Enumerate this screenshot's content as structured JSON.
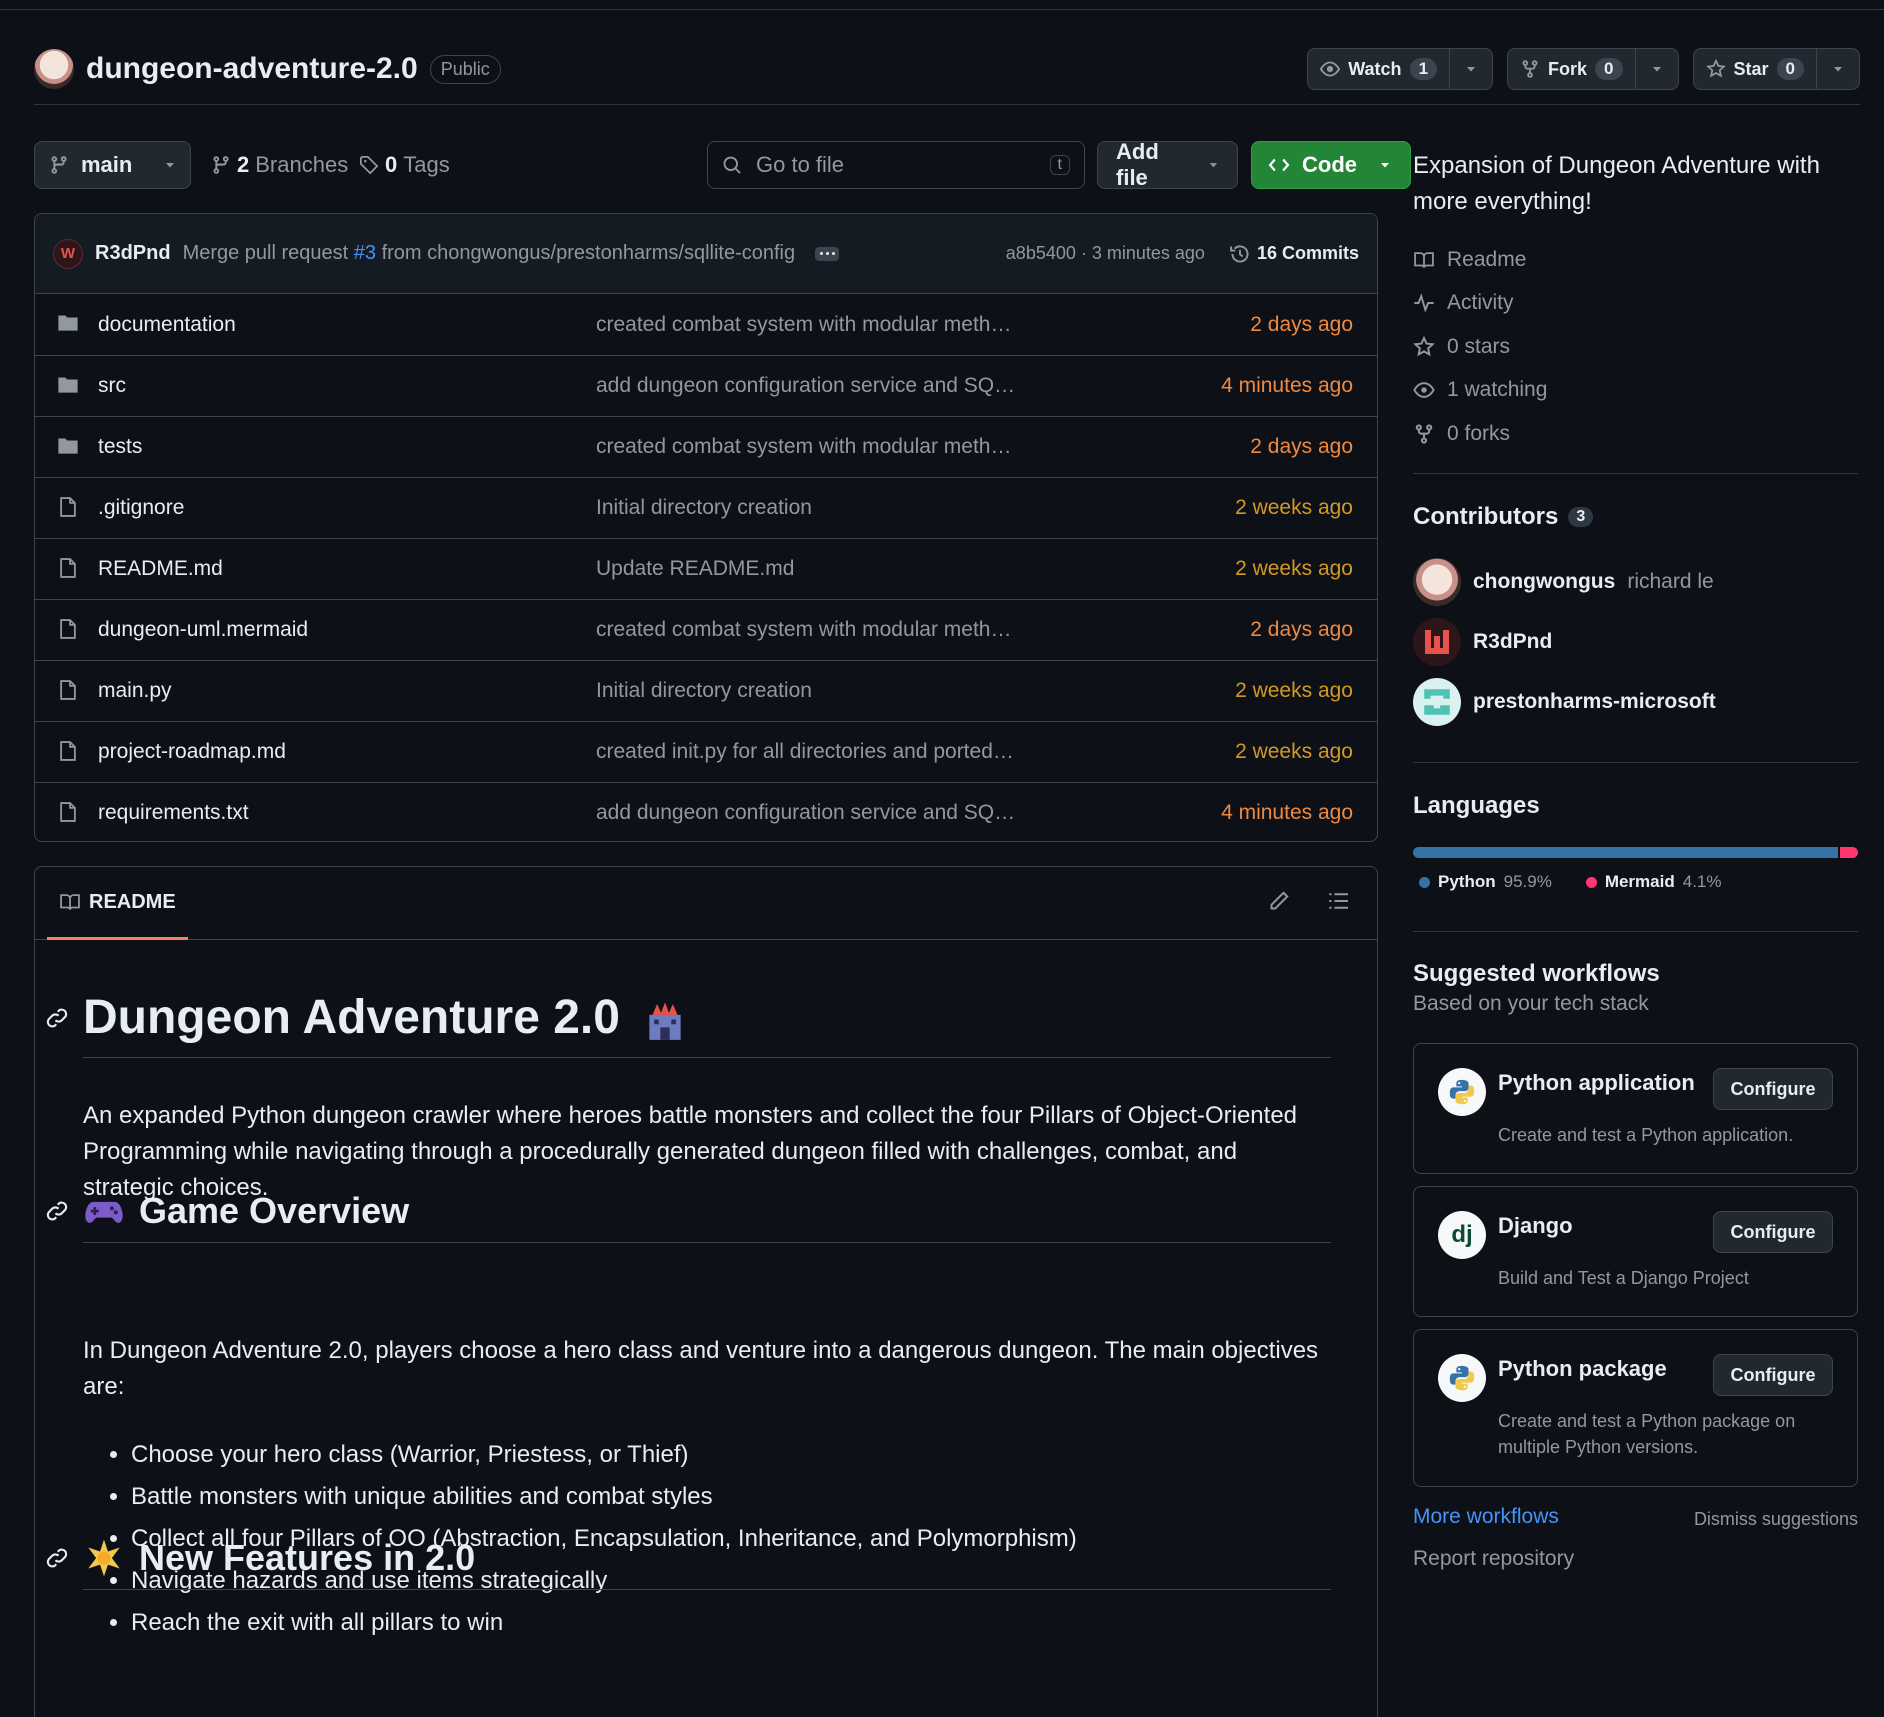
{
  "repo": {
    "name": "dungeon-adventure-2.0",
    "visibility": "Public",
    "watch_label": "Watch",
    "watch_count": "1",
    "fork_label": "Fork",
    "fork_count": "0",
    "star_label": "Star",
    "star_count": "0"
  },
  "toolbar": {
    "branch": "main",
    "branches_count": "2",
    "branches_label": "Branches",
    "tags_count": "0",
    "tags_label": "Tags",
    "search_placeholder": "Go to file",
    "search_shortcut": "t",
    "add_file_label": "Add file",
    "code_label": "Code"
  },
  "commit": {
    "author": "R3dPnd",
    "avatar_text": "W",
    "message_prefix": "Merge pull request ",
    "pr": "#3",
    "message_suffix": " from chongwongus/prestonharms/sqllite-config",
    "meta": "a8b5400 · 3 minutes ago",
    "count_label": "16 Commits"
  },
  "files": [
    {
      "type": "folder",
      "name": "documentation",
      "message": "created combat system with modular methods, and demo",
      "time": "2 days ago"
    },
    {
      "type": "folder",
      "name": "src",
      "message": "add dungeon configuration service and SQLite monster conf...",
      "time": "4 minutes ago"
    },
    {
      "type": "folder",
      "name": "tests",
      "message": "created combat system with modular methods, and demo",
      "time": "2 days ago"
    },
    {
      "type": "file",
      "name": ".gitignore",
      "message": "Initial directory creation",
      "time": "2 weeks ago"
    },
    {
      "type": "file",
      "name": "README.md",
      "message": "Update README.md",
      "time": "2 weeks ago"
    },
    {
      "type": "file",
      "name": "dungeon-uml.mermaid",
      "message": "created combat system with modular methods, and demo",
      "time": "2 days ago"
    },
    {
      "type": "file",
      "name": "main.py",
      "message": "Initial directory creation",
      "time": "2 weeks ago"
    },
    {
      "type": "file",
      "name": "project-roadmap.md",
      "message": "created init.py for all directories and ported over dungeon cr...",
      "time": "2 weeks ago"
    },
    {
      "type": "file",
      "name": "requirements.txt",
      "message": "add dungeon configuration service and SQLite monster conf...",
      "time": "4 minutes ago"
    }
  ],
  "readme": {
    "tab_label": "README",
    "h1": "Dungeon Adventure 2.0",
    "h1_emoji": "castle",
    "intro": "An expanded Python dungeon crawler where heroes battle monsters and collect the four Pillars of Object-Oriented Programming while navigating through a procedurally generated dungeon filled with challenges, combat, and strategic choices.",
    "h2_overview": "Game Overview",
    "h2_overview_emoji": "gamepad",
    "overview_text": "In Dungeon Adventure 2.0, players choose a hero class and venture into a dangerous dungeon. The main objectives are:",
    "objectives": [
      "Choose your hero class (Warrior, Priestess, or Thief)",
      "Battle monsters with unique abilities and combat styles",
      "Collect all four Pillars of OO (Abstraction, Encapsulation, Inheritance, and Polymorphism)",
      "Navigate hazards and use items strategically",
      "Reach the exit with all pillars to win"
    ],
    "h2_features": "New Features in 2.0",
    "h2_features_emoji": "sparkle-star"
  },
  "sidebar": {
    "about": "Expansion of Dungeon Adventure with more everything!",
    "links": [
      {
        "icon": "book-icon",
        "label": "Readme"
      },
      {
        "icon": "pulse-icon",
        "label": "Activity"
      },
      {
        "icon": "star-icon",
        "label": "0 stars"
      },
      {
        "icon": "eye-icon",
        "label": "1 watching"
      },
      {
        "icon": "fork-icon",
        "label": "0 forks"
      }
    ],
    "contributors_title": "Contributors",
    "contributors_count": "3",
    "contributors": [
      {
        "login": "chongwongus",
        "name": "richard le"
      },
      {
        "login": "R3dPnd",
        "name": ""
      },
      {
        "login": "prestonharms-microsoft",
        "name": ""
      }
    ],
    "languages_title": "Languages",
    "languages": [
      {
        "name": "Python",
        "percent": "95.9%",
        "value": 95.9,
        "color": "#3572A5"
      },
      {
        "name": "Mermaid",
        "percent": "4.1%",
        "value": 4.1,
        "color": "#ff3670"
      }
    ],
    "workflows_title": "Suggested workflows",
    "workflows_subtitle": "Based on your tech stack",
    "workflows": [
      {
        "title": "Python application",
        "desc": "Create and test a Python application.",
        "button": "Configure",
        "icon": "python-icon"
      },
      {
        "title": "Django",
        "desc": "Build and Test a Django Project",
        "button": "Configure",
        "icon": "django-icon",
        "icon_text": "dj"
      },
      {
        "title": "Python package",
        "desc": "Create and test a Python package on multiple Python versions.",
        "button": "Configure",
        "icon": "python-icon"
      }
    ],
    "more_workflows": "More workflows",
    "dismiss": "Dismiss suggestions",
    "report": "Report repository"
  },
  "colors": {
    "accent_link": "#4493f8",
    "primary_button": "#238636",
    "recent_time": "#f0883e",
    "older_time": "#d29922"
  }
}
